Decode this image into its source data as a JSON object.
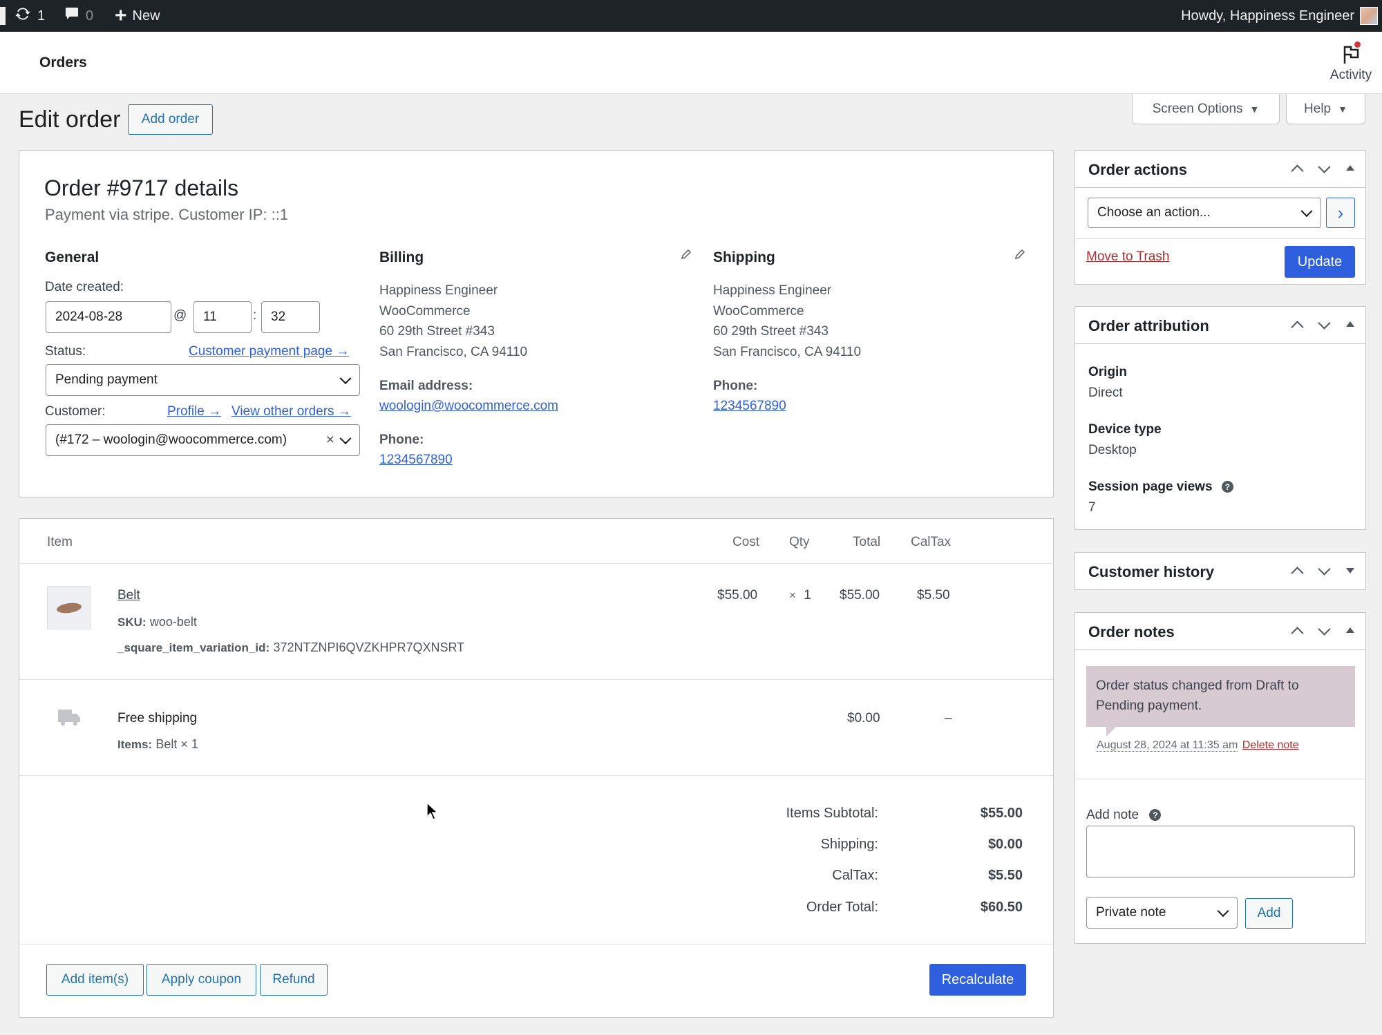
{
  "admin_bar": {
    "updates_count": "1",
    "comments_count": "0",
    "new_label": "New",
    "howdy": "Howdy, Happiness Engineer"
  },
  "header": {
    "title": "Orders",
    "activity_label": "Activity"
  },
  "screen_options_label": "Screen Options",
  "help_label": "Help",
  "page": {
    "title": "Edit order",
    "add_order_label": "Add order"
  },
  "order": {
    "heading": "Order #9717 details",
    "subtitle": "Payment via stripe. Customer IP: ::1",
    "general": {
      "heading": "General",
      "date_created_label": "Date created:",
      "date": "2024-08-28",
      "at": "@",
      "hour": "11",
      "colon": ":",
      "minute": "32",
      "status_label": "Status:",
      "customer_payment_link": "Customer payment page →",
      "status_value": "Pending payment",
      "customer_label": "Customer:",
      "profile_link": "Profile →",
      "view_orders_link": "View other orders →",
      "customer_value": "(#172 – woologin@woocommerce.com)",
      "clear_symbol": "×"
    },
    "billing": {
      "heading": "Billing",
      "address": [
        "Happiness Engineer",
        "WooCommerce",
        "60 29th Street #343",
        "San Francisco, CA 94110"
      ],
      "email_label": "Email address:",
      "email": "woologin@woocommerce.com",
      "phone_label": "Phone:",
      "phone": "1234567890"
    },
    "shipping": {
      "heading": "Shipping",
      "address": [
        "Happiness Engineer",
        "WooCommerce",
        "60 29th Street #343",
        "San Francisco, CA 94110"
      ],
      "phone_label": "Phone:",
      "phone": "1234567890"
    }
  },
  "items": {
    "headers": {
      "item": "Item",
      "cost": "Cost",
      "qty": "Qty",
      "total": "Total",
      "tax": "CalTax"
    },
    "product": {
      "name": "Belt",
      "sku_label": "SKU:",
      "sku": "woo-belt",
      "meta_label": "_square_item_variation_id:",
      "meta_value": "372NTZNPI6QVZKHPR7QXNSRT",
      "cost": "$55.00",
      "qty_symbol": "×",
      "qty": "1",
      "total": "$55.00",
      "tax": "$5.50"
    },
    "shipping_line": {
      "name": "Free shipping",
      "items_label": "Items:",
      "items_value": "Belt × 1",
      "total": "$0.00",
      "tax": "–"
    },
    "totals": [
      {
        "label": "Items Subtotal:",
        "value": "$55.00"
      },
      {
        "label": "Shipping:",
        "value": "$0.00"
      },
      {
        "label": "CalTax:",
        "value": "$5.50"
      },
      {
        "label": "Order Total:",
        "value": "$60.50"
      }
    ],
    "buttons": {
      "add_items": "Add item(s)",
      "apply_coupon": "Apply coupon",
      "refund": "Refund",
      "recalculate": "Recalculate"
    }
  },
  "sidebar": {
    "order_actions": {
      "title": "Order actions",
      "select_value": "Choose an action...",
      "go": "›",
      "trash": "Move to Trash",
      "update": "Update"
    },
    "attribution": {
      "title": "Order attribution",
      "origin_label": "Origin",
      "origin": "Direct",
      "device_label": "Device type",
      "device": "Desktop",
      "views_label": "Session page views",
      "views": "7",
      "help": "?"
    },
    "customer_history": {
      "title": "Customer history"
    },
    "notes": {
      "title": "Order notes",
      "note_text": "Order status changed from Draft to Pending payment.",
      "note_date": "August 28, 2024 at 11:35 am",
      "delete_note": "Delete note",
      "add_note_label": "Add note",
      "help": "?",
      "note_type": "Private note",
      "add_button": "Add"
    }
  },
  "colors": {
    "primary": "#2d5fde",
    "admin_bar": "#1d2327",
    "note_bg": "#d7cad2",
    "delete": "#b32d2e"
  }
}
